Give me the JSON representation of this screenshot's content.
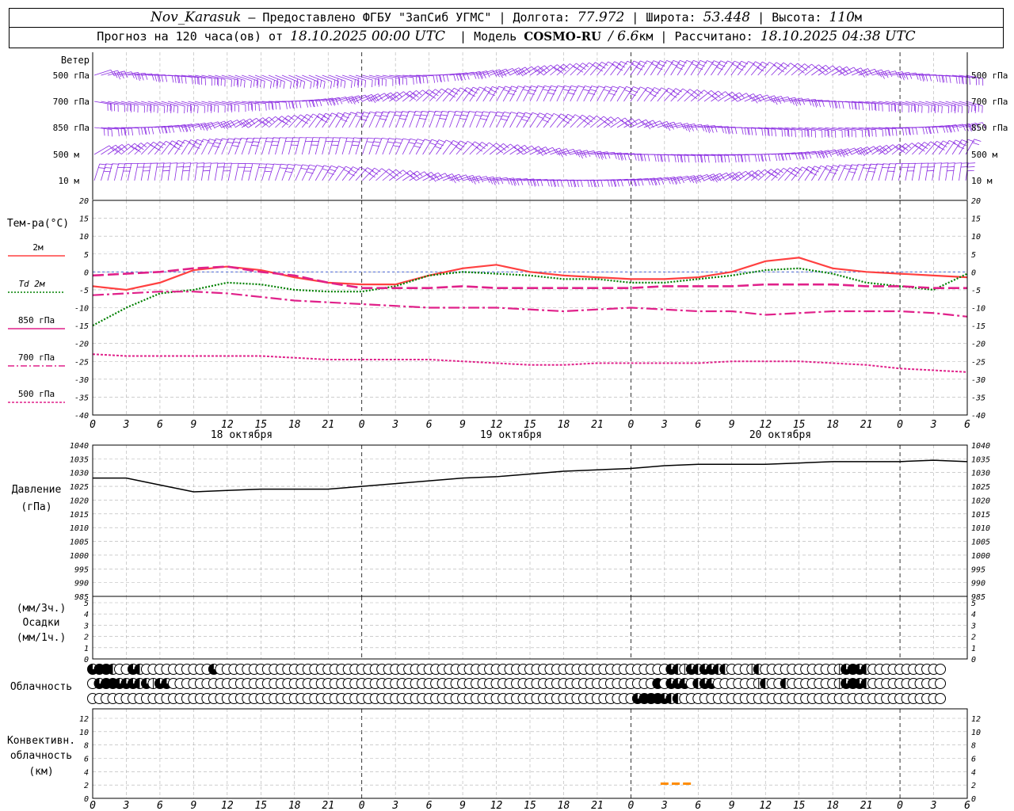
{
  "header": {
    "station": "Nov_Karasuk",
    "provided_by": "– Предоставлено ФГБУ \"ЗапСиб УГМС\"",
    "lon_label": "Долгота:",
    "lon_value": "77.972",
    "lat_label": "Широта:",
    "lat_value": "53.448",
    "alt_label": "Высота:",
    "alt_value": "110",
    "alt_unit": "м",
    "forecast_prefix": "Прогноз на 120 часа(ов) от",
    "forecast_start": "18.10.2025 00:00 UTC",
    "model_label": "Модель",
    "model_name": "COSMO-RU",
    "model_res": "/ 6.6",
    "model_res_unit": "км",
    "calc_label": "Рассчитано:",
    "calc_time": "18.10.2025 04:38 UTC"
  },
  "wind_panel": {
    "title": "Ветер",
    "levels": [
      "500 гПа",
      "700 гПа",
      "850 гПа",
      "500 м",
      "10  м"
    ],
    "levels_right": [
      "500 гПа",
      "700 гПа",
      "850 гПа",
      "500 м",
      "10  м"
    ],
    "color": "#8a2be2"
  },
  "temp_panel": {
    "title": "Тем-ра(°С)",
    "legend": [
      {
        "label": "2м",
        "color": "#ff4040",
        "style": "solid"
      },
      {
        "label": "Td  2м",
        "color": "#008000",
        "style": "dotted"
      },
      {
        "label": "850 гПа",
        "color": "#e0218a",
        "style": "dashed"
      },
      {
        "label": "700 гПа",
        "color": "#e0218a",
        "style": "dashdot"
      },
      {
        "label": "500 гПа",
        "color": "#e0218a",
        "style": "dot"
      }
    ],
    "y_ticks": [
      "20",
      "15",
      "10",
      "5",
      "0",
      "-5",
      "-10",
      "-15",
      "-20",
      "-25",
      "-30",
      "-35",
      "-40"
    ]
  },
  "time_axis": {
    "hour_labels": [
      "0",
      "3",
      "6",
      "9",
      "12",
      "15",
      "18",
      "21",
      "0",
      "3",
      "6",
      "9",
      "12",
      "15",
      "18",
      "21",
      "0",
      "3",
      "6",
      "9",
      "12",
      "15",
      "18",
      "21",
      "0",
      "3",
      "6"
    ],
    "date_labels": [
      "18 октября",
      "19 октября",
      "20 октября"
    ]
  },
  "pressure_panel": {
    "title": "Давление",
    "unit": "(гПа)",
    "y_ticks": [
      "1040",
      "1035",
      "1030",
      "1025",
      "1020",
      "1015",
      "1010",
      "1005",
      "1000",
      "995",
      "990",
      "985"
    ]
  },
  "precip_panel": {
    "unit_3h": "(мм/3ч.)",
    "title": "Осадки",
    "unit_1h": "(мм/1ч.)",
    "y_ticks": [
      "5",
      "4",
      "3",
      "2",
      "1",
      "0"
    ]
  },
  "cloud_panel": {
    "title": "Облачность",
    "rows": [
      [
        3,
        4,
        4,
        2,
        0,
        0,
        3,
        2,
        0,
        0,
        0,
        0,
        0,
        0,
        0,
        0,
        0,
        0,
        3,
        0,
        0,
        0,
        0,
        0,
        0,
        0,
        0,
        0,
        0,
        0,
        0,
        0,
        0,
        0,
        0,
        0,
        0,
        0,
        0,
        0,
        0,
        0,
        0,
        0,
        0,
        0,
        0,
        0,
        0,
        0,
        0,
        0,
        0,
        0,
        0,
        0,
        0,
        0,
        0,
        0,
        0,
        0,
        0,
        0,
        0,
        0,
        0,
        0,
        0,
        0,
        0,
        0,
        0,
        0,
        0,
        0,
        0,
        0,
        0,
        0,
        0,
        0,
        0,
        0,
        0,
        0,
        3,
        2,
        1,
        3,
        2,
        3,
        3,
        2,
        2,
        0,
        0,
        0,
        1,
        2,
        0,
        0,
        0,
        0,
        0,
        0,
        0,
        0,
        0,
        0,
        0,
        1,
        3,
        4,
        3,
        2,
        0,
        0,
        0,
        0,
        0,
        0,
        0,
        0,
        0,
        0,
        0
      ],
      [
        0,
        3,
        4,
        4,
        3,
        3,
        3,
        2,
        3,
        1,
        3,
        3,
        0,
        0,
        0,
        0,
        0,
        0,
        0,
        0,
        0,
        0,
        0,
        0,
        0,
        0,
        0,
        0,
        0,
        0,
        0,
        0,
        0,
        0,
        0,
        0,
        0,
        0,
        0,
        0,
        0,
        0,
        0,
        0,
        0,
        0,
        0,
        0,
        0,
        0,
        0,
        0,
        0,
        0,
        0,
        0,
        0,
        0,
        0,
        0,
        0,
        0,
        0,
        0,
        0,
        0,
        0,
        0,
        0,
        0,
        0,
        0,
        0,
        0,
        0,
        0,
        0,
        0,
        0,
        0,
        0,
        0,
        0,
        0,
        4,
        0,
        3,
        3,
        3,
        0,
        2,
        3,
        3,
        0,
        0,
        0,
        0,
        0,
        0,
        1,
        2,
        0,
        0,
        2,
        0,
        0,
        0,
        0,
        0,
        0,
        0,
        1,
        3,
        4,
        3,
        2,
        0,
        0,
        0,
        0,
        0,
        0,
        0,
        0,
        0,
        0,
        0
      ],
      [
        0,
        0,
        0,
        0,
        0,
        0,
        0,
        0,
        0,
        0,
        0,
        0,
        0,
        0,
        0,
        0,
        0,
        0,
        0,
        0,
        0,
        0,
        0,
        0,
        0,
        0,
        0,
        0,
        0,
        0,
        0,
        0,
        0,
        0,
        0,
        0,
        0,
        0,
        0,
        0,
        0,
        0,
        0,
        0,
        0,
        0,
        0,
        0,
        0,
        0,
        0,
        0,
        0,
        0,
        0,
        0,
        0,
        0,
        0,
        0,
        0,
        0,
        0,
        0,
        0,
        0,
        0,
        0,
        0,
        0,
        0,
        0,
        0,
        0,
        0,
        0,
        0,
        0,
        0,
        0,
        0,
        3,
        4,
        4,
        4,
        3,
        2,
        2,
        0,
        0,
        0,
        0,
        0,
        0,
        0,
        0,
        0,
        0,
        0,
        0,
        0,
        0,
        0,
        0,
        0,
        0,
        0,
        0,
        0,
        0,
        0,
        0,
        0,
        0,
        0,
        0,
        0,
        0,
        0,
        0,
        0,
        0,
        0,
        0,
        0,
        0,
        0
      ]
    ]
  },
  "conv_panel": {
    "title1": "Конвективн.",
    "title2": "облачность",
    "unit": "(км)",
    "y_ticks": [
      "12",
      "10",
      "8",
      "6",
      "4",
      "2",
      "0"
    ]
  },
  "chart_data": [
    {
      "type": "line",
      "title": "Тем-ра(°С)",
      "x_unit": "hours since 18.10.2025 00:00 UTC",
      "ylim": [
        -40,
        20
      ],
      "x": [
        0,
        3,
        6,
        9,
        12,
        15,
        18,
        21,
        24,
        27,
        30,
        33,
        36,
        39,
        42,
        45,
        48,
        51,
        54,
        57,
        60,
        63,
        66,
        69,
        72,
        75,
        78
      ],
      "series": [
        {
          "name": "2м",
          "color": "#ff4040",
          "values": [
            -4,
            -5,
            -3,
            0.5,
            1.5,
            0.5,
            -1.5,
            -3,
            -3.5,
            -3.5,
            -1,
            1,
            2,
            0,
            -1,
            -1.5,
            -2,
            -2,
            -1.5,
            0,
            3,
            4,
            1,
            0,
            -0.5,
            -1,
            -1.5
          ]
        },
        {
          "name": "Td  2м",
          "color": "#008000",
          "values": [
            -15,
            -10,
            -6,
            -5,
            -3,
            -3.5,
            -5,
            -5.5,
            -5.5,
            -4,
            -1,
            0,
            -0.5,
            -1,
            -2,
            -2,
            -3,
            -3,
            -2,
            -1,
            0.5,
            1,
            -0.5,
            -3,
            -4,
            -5,
            -0.5
          ]
        },
        {
          "name": "850 гПа",
          "color": "#e0218a",
          "values": [
            -1,
            -0.5,
            0,
            1,
            1.5,
            0,
            -1,
            -3,
            -4.5,
            -4.5,
            -4.5,
            -4,
            -4.5,
            -4.5,
            -4.5,
            -4.5,
            -4.5,
            -4,
            -4,
            -4,
            -3.5,
            -3.5,
            -3.5,
            -4,
            -4,
            -4.5,
            -4.5
          ]
        },
        {
          "name": "700 гПа",
          "color": "#e0218a",
          "values": [
            -6.5,
            -6,
            -5.5,
            -5.5,
            -6,
            -7,
            -8,
            -8.5,
            -9,
            -9.5,
            -10,
            -10,
            -10,
            -10.5,
            -11,
            -10.5,
            -10,
            -10.5,
            -11,
            -11,
            -12,
            -11.5,
            -11,
            -11,
            -11,
            -11.5,
            -12.5
          ]
        },
        {
          "name": "500 гПа",
          "color": "#e0218a",
          "values": [
            -23,
            -23.5,
            -23.5,
            -23.5,
            -23.5,
            -23.5,
            -24,
            -24.5,
            -24.5,
            -24.5,
            -24.5,
            -25,
            -25.5,
            -26,
            -26,
            -25.5,
            -25.5,
            -25.5,
            -25.5,
            -25,
            -25,
            -25,
            -25.5,
            -26,
            -27,
            -27.5,
            -28
          ]
        }
      ]
    },
    {
      "type": "line",
      "title": "Давление",
      "x_unit": "hours since 18.10.2025 00:00 UTC",
      "ylim": [
        985,
        1040
      ],
      "x": [
        0,
        3,
        6,
        9,
        12,
        15,
        18,
        21,
        24,
        27,
        30,
        33,
        36,
        39,
        42,
        45,
        48,
        51,
        54,
        57,
        60,
        63,
        66,
        69,
        72,
        75,
        78
      ],
      "series": [
        {
          "name": "",
          "color": "#000000",
          "values": [
            1028,
            1028,
            1025.5,
            1023,
            1023.5,
            1024,
            1024,
            1024,
            1025,
            1026,
            1027,
            1028,
            1028.5,
            1029.5,
            1030.5,
            1031,
            1031.5,
            1032.5,
            1033,
            1033,
            1033,
            1033.5,
            1034,
            1034,
            1034,
            1034.5,
            1034
          ]
        }
      ]
    },
    {
      "type": "bar",
      "title": "Осадки",
      "ylim": [
        0,
        5
      ],
      "x": [],
      "values": []
    },
    {
      "type": "bar",
      "title": "Конвективн. облачность",
      "x_unit": "hours since 18.10.2025 00:00 UTC",
      "ylim": [
        0,
        13
      ],
      "x": [
        51,
        52,
        53
      ],
      "values": [
        2.2,
        2.2,
        2.2
      ],
      "color": "#ff8c00"
    }
  ]
}
